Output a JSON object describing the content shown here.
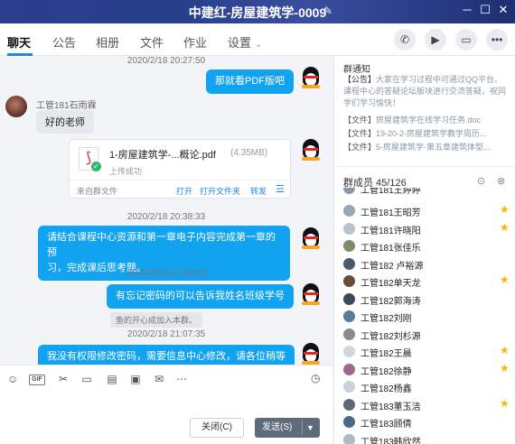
{
  "window": {
    "title": "中建红-房屋建筑学-0009",
    "edit_icon": "pencil-icon",
    "controls": [
      "minimize",
      "maximize",
      "close"
    ]
  },
  "tabs": [
    {
      "label": "聊天",
      "active": true
    },
    {
      "label": "公告"
    },
    {
      "label": "相册"
    },
    {
      "label": "文件"
    },
    {
      "label": "作业"
    },
    {
      "label": "设置"
    }
  ],
  "header_actions": [
    "phone-icon",
    "video-icon",
    "share-screen-icon",
    "more-icon"
  ],
  "chat": {
    "messages": [
      {
        "time": "2020/2/18 20:27:50",
        "text": "那就看PDF版吧",
        "from": "self"
      },
      {
        "sender": "工管181石雨霖",
        "text": "好的老师",
        "from": "other"
      },
      {
        "file": {
          "name": "1-房屋建筑学-...概论.pdf",
          "size": "(4.35MB)",
          "status": "上传成功",
          "source": "来自群文件",
          "actions": [
            "打开",
            "打开文件夹",
            "转发"
          ]
        },
        "from": "self"
      },
      {
        "time": "2020/2/18 20:38:33",
        "text_lines": [
          "请结合课程中心资源和第一章电子内容完成第一章的预",
          "习，完成课后思考题。"
        ],
        "from": "self"
      },
      {
        "time": "2020/2/18 20:48:39",
        "text": "有忘记密码的可以告诉我姓名班级学号",
        "from": "self"
      },
      {
        "system": "鱼的开心成加入本群。"
      },
      {
        "time": "2020/2/18 21:07:35",
        "text": "我没有权限修改密码，需要信息中心修改，请各位稍等",
        "from": "self"
      }
    ]
  },
  "toolbar": {
    "tools": [
      "emoji-icon",
      "gif-icon",
      "scissors-icon",
      "folder-icon",
      "document-icon",
      "image-icon",
      "mail-icon",
      "more-dots-icon"
    ],
    "gif_label": "GIF",
    "history_icon": "clock-icon"
  },
  "buttons": {
    "close_label": "关闭(C)",
    "send_label": "发送(S)"
  },
  "notice": {
    "title": "群通知",
    "announcement_tag": "【公告】",
    "announcement_text": "大家在学习过程中可通过QQ平台、课程中心的答疑论坛版块进行交流答疑，祝同学们学习愉快！",
    "files": [
      {
        "tag": "【文件】",
        "text": "房屋建筑学在线学习任务.doc"
      },
      {
        "tag": "【文件】",
        "text": "19-20-2-房屋建筑学教学周历..."
      },
      {
        "tag": "【文件】",
        "text": "5-房屋建筑学-第五章建筑体型..."
      }
    ]
  },
  "members": {
    "title": "群成员 45/126",
    "partial_top": "工管181王婷婷",
    "list": [
      {
        "name": "工管181王昭芳",
        "star": true,
        "color": "#9aa6b2"
      },
      {
        "name": "工管181许晓阳",
        "star": true,
        "color": "#b7c4d0"
      },
      {
        "name": "工管181张佳乐",
        "star": false,
        "color": "#7f8c6a"
      },
      {
        "name": "工管182 卢裕源",
        "star": false,
        "color": "#4a5a6a"
      },
      {
        "name": "工管182单天龙",
        "star": true,
        "color": "#6a4a3a"
      },
      {
        "name": "工管182郭海涛",
        "star": false,
        "color": "#3a4a5a"
      },
      {
        "name": "工管182刘刚",
        "star": false,
        "color": "#5a7a9a"
      },
      {
        "name": "工管182刘杉源",
        "star": false,
        "color": "#8a8a8a"
      },
      {
        "name": "工管182王晨",
        "star": true,
        "color": "#cfd6dd"
      },
      {
        "name": "工管182徐静",
        "star": true,
        "color": "#9a6a8a"
      },
      {
        "name": "工管182杨鑫",
        "star": false,
        "color": "#c9d2da"
      },
      {
        "name": "工管183董玉洁",
        "star": true,
        "color": "#5a6a7a"
      },
      {
        "name": "工管183顾倩",
        "star": false,
        "color": "#4a6a8a"
      },
      {
        "name": "工管183韩欣然",
        "star": false,
        "color": "#b0b8c0"
      }
    ]
  },
  "colors": {
    "accent": "#1e88e5",
    "bubble": "#12a3f0",
    "star": "#f5b70a"
  }
}
